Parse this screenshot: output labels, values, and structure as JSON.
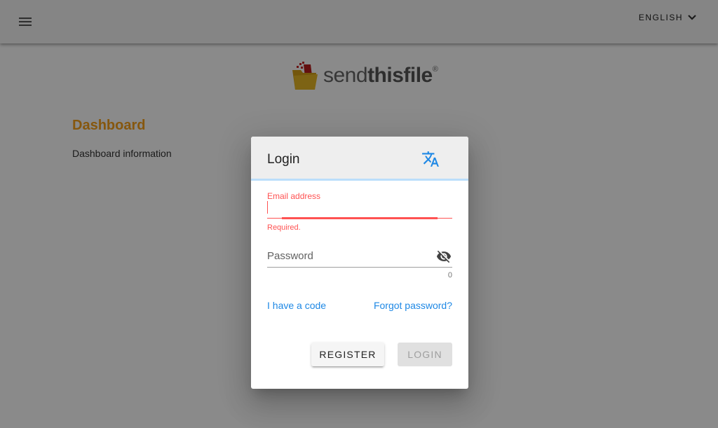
{
  "header": {
    "language": "ENGLISH",
    "menu_icon": "hamburger-menu-icon",
    "language_icon": "chevron-down-icon"
  },
  "brand": {
    "logo_light": "send",
    "logo_bold": "thisfile",
    "logo_mark": "®"
  },
  "dashboard": {
    "title": "Dashboard",
    "info": "Dashboard information"
  },
  "login_dialog": {
    "title": "Login",
    "translate_icon": "translate-icon",
    "email": {
      "label": "Email address",
      "value": "",
      "error": "Required."
    },
    "password": {
      "placeholder": "Password",
      "value": "",
      "counter": "0",
      "visibility_icon": "eye-off-icon"
    },
    "links": {
      "code": "I have a code",
      "forgot": "Forgot password?"
    },
    "buttons": {
      "register": "REGISTER",
      "login": "LOGIN"
    }
  },
  "colors": {
    "accent_orange": "#f7a21b",
    "link_blue": "#1e88e5",
    "error_red": "#ff5252",
    "header_underline": "#bbdefb"
  }
}
